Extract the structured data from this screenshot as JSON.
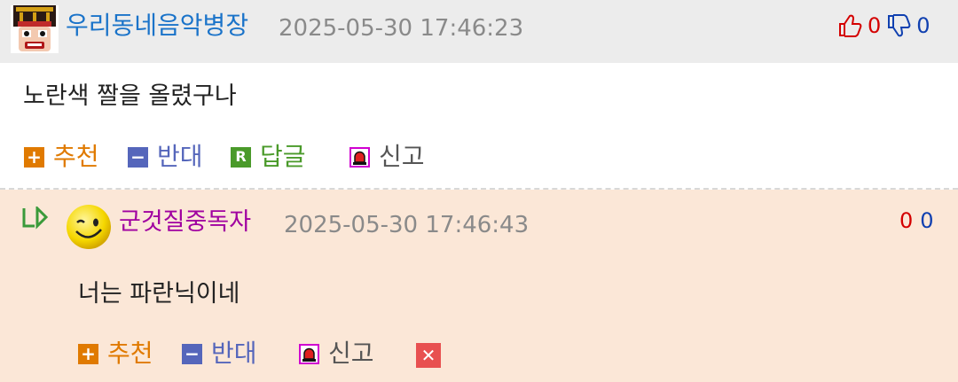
{
  "comment": {
    "author": "우리동네음악병장",
    "timestamp": "2025-05-30 17:46:23",
    "upvotes": "0",
    "downvotes": "0",
    "text": "노란색 짤을 올렸구나",
    "actions": {
      "recommend": "추천",
      "oppose": "반대",
      "reply_icon": "R",
      "reply": "답글",
      "report": "신고"
    }
  },
  "reply": {
    "author": "군것질중독자",
    "timestamp": "2025-05-30 17:46:43",
    "upvotes": "0",
    "downvotes": "0",
    "text": "너는 파란닉이네",
    "actions": {
      "recommend": "추천",
      "oppose": "반대",
      "report": "신고"
    }
  },
  "colors": {
    "author_primary": "#1a73c9",
    "author_reply": "#a000a0",
    "recommend": "#e07a00",
    "oppose": "#5566bb",
    "reply_green": "#4a9a2a",
    "report_magenta": "#d000d0",
    "delete_red": "#e85050"
  },
  "icons": [
    "nutcracker-avatar",
    "thumbs-up-icon",
    "thumbs-down-icon",
    "plus-icon",
    "minus-icon",
    "reply-icon",
    "siren-icon",
    "reply-arrow-icon",
    "smiley-avatar",
    "delete-x-icon"
  ]
}
